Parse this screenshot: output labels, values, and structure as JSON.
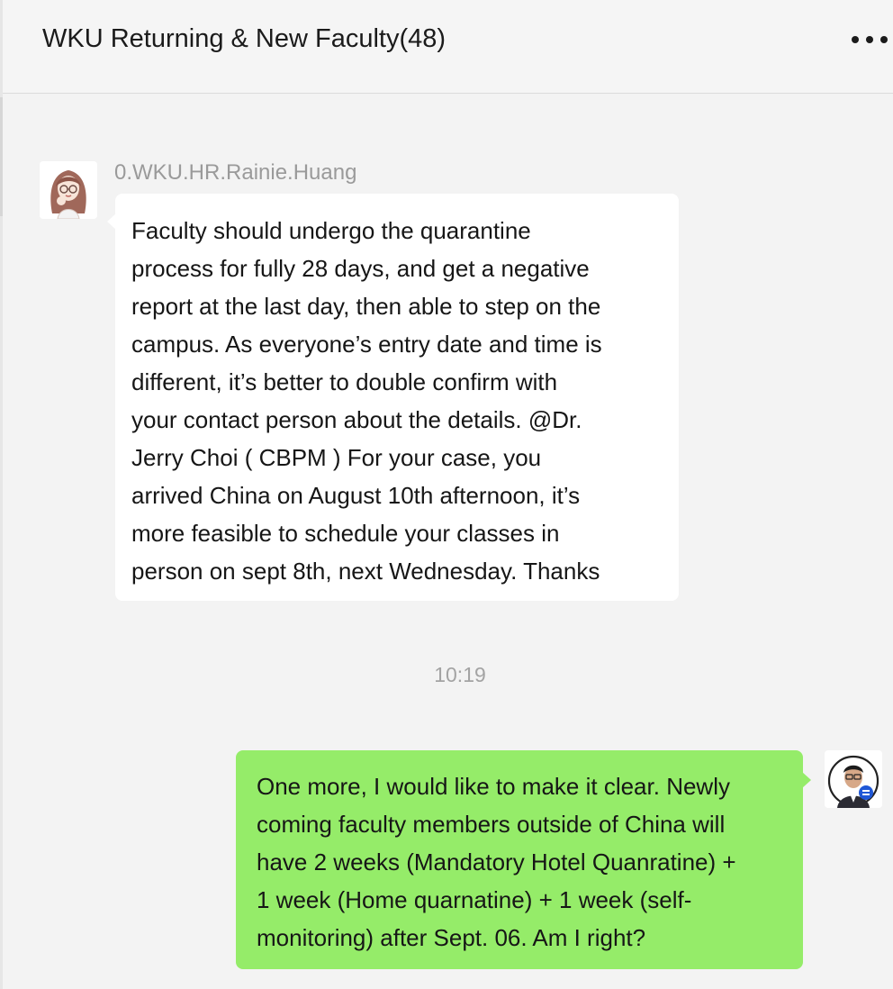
{
  "chat": {
    "title": "WKU Returning & New Faculty(48)",
    "more_icon": "more-dots-icon",
    "messages": [
      {
        "sender": "0.WKU.HR.Rainie.Huang",
        "avatar": "avatar-illustrated-woman-icon",
        "direction": "incoming",
        "text": "Faculty should undergo the quarantine\nprocess for fully 28 days, and get a negative\nreport at the last day, then able to step on the\ncampus. As everyone’s entry date and time is\ndifferent, it’s better to double confirm with\nyour contact person about the details.  @Dr.\nJerry Choi ( CBPM )  For your case, you\narrived China on August 10th afternoon, it’s\nmore feasible to schedule your classes in\nperson on sept 8th, next Wednesday. Thanks"
      },
      {
        "timestamp": "10:19"
      },
      {
        "avatar": "avatar-man-with-badge-icon",
        "direction": "outgoing",
        "text": "One more, I would like to make it clear.  Newly\ncoming faculty members outside of China will\nhave 2 weeks (Mandatory Hotel Quanratine) +\n1 week (Home quarnatine) + 1 week (self-\nmonitoring) after Sept. 06. Am I right?"
      }
    ]
  },
  "colors": {
    "incoming_bubble": "#ffffff",
    "outgoing_bubble": "#95ec69",
    "background": "#f3f3f3",
    "meta_text": "#9a9a9a"
  }
}
